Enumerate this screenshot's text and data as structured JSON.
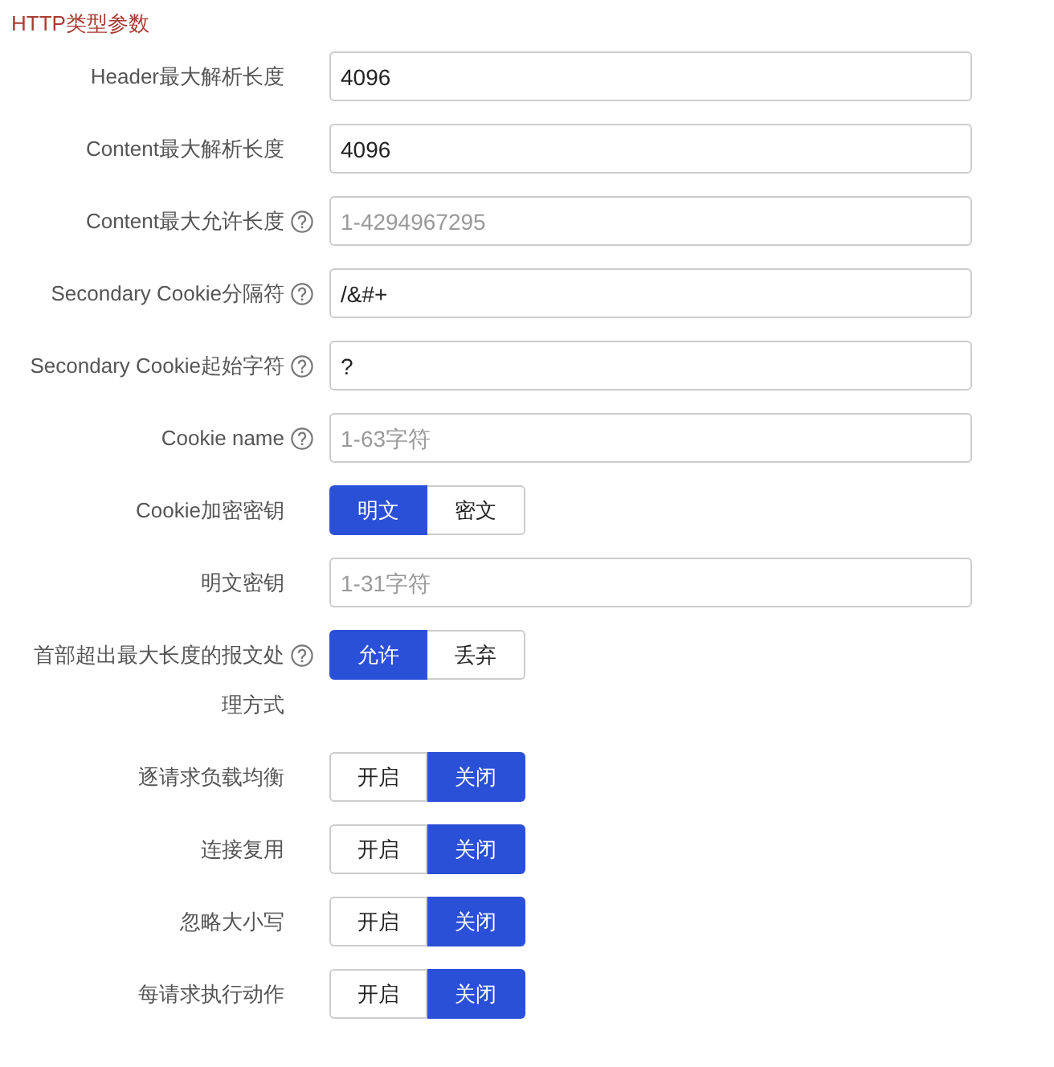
{
  "section_title": "HTTP类型参数",
  "rows": [
    {
      "kind": "input",
      "label": "Header最大解析长度",
      "help": false,
      "value": "4096"
    },
    {
      "kind": "input",
      "label": "Content最大解析长度",
      "help": false,
      "value": "4096"
    },
    {
      "kind": "input",
      "label": "Content最大允许长度",
      "help": true,
      "placeholder": "1-4294967295"
    },
    {
      "kind": "input",
      "label": "Secondary Cookie分隔符",
      "help": true,
      "value": "/&#+"
    },
    {
      "kind": "input",
      "label": "Secondary Cookie起始字符",
      "help": true,
      "value": "?"
    },
    {
      "kind": "input",
      "label": "Cookie name",
      "help": true,
      "placeholder": "1-63字符"
    },
    {
      "kind": "segmented",
      "label": "Cookie加密密钥",
      "help": false,
      "options": [
        {
          "label": "明文",
          "selected": true
        },
        {
          "label": "密文",
          "selected": false
        }
      ]
    },
    {
      "kind": "input",
      "label": "明文密钥",
      "help": false,
      "placeholder": "1-31字符"
    },
    {
      "kind": "segmented",
      "label": "首部超出最大长度的报文处理方式",
      "help": true,
      "options": [
        {
          "label": "允许",
          "selected": true
        },
        {
          "label": "丢弃",
          "selected": false
        }
      ]
    },
    {
      "kind": "segmented",
      "label": "逐请求负载均衡",
      "help": false,
      "options": [
        {
          "label": "开启",
          "selected": false
        },
        {
          "label": "关闭",
          "selected": true
        }
      ]
    },
    {
      "kind": "segmented",
      "label": "连接复用",
      "help": false,
      "options": [
        {
          "label": "开启",
          "selected": false
        },
        {
          "label": "关闭",
          "selected": true
        }
      ]
    },
    {
      "kind": "segmented",
      "label": "忽略大小写",
      "help": false,
      "options": [
        {
          "label": "开启",
          "selected": false
        },
        {
          "label": "关闭",
          "selected": true
        }
      ]
    },
    {
      "kind": "segmented",
      "label": "每请求执行动作",
      "help": false,
      "options": [
        {
          "label": "开启",
          "selected": false
        },
        {
          "label": "关闭",
          "selected": true
        }
      ]
    }
  ]
}
